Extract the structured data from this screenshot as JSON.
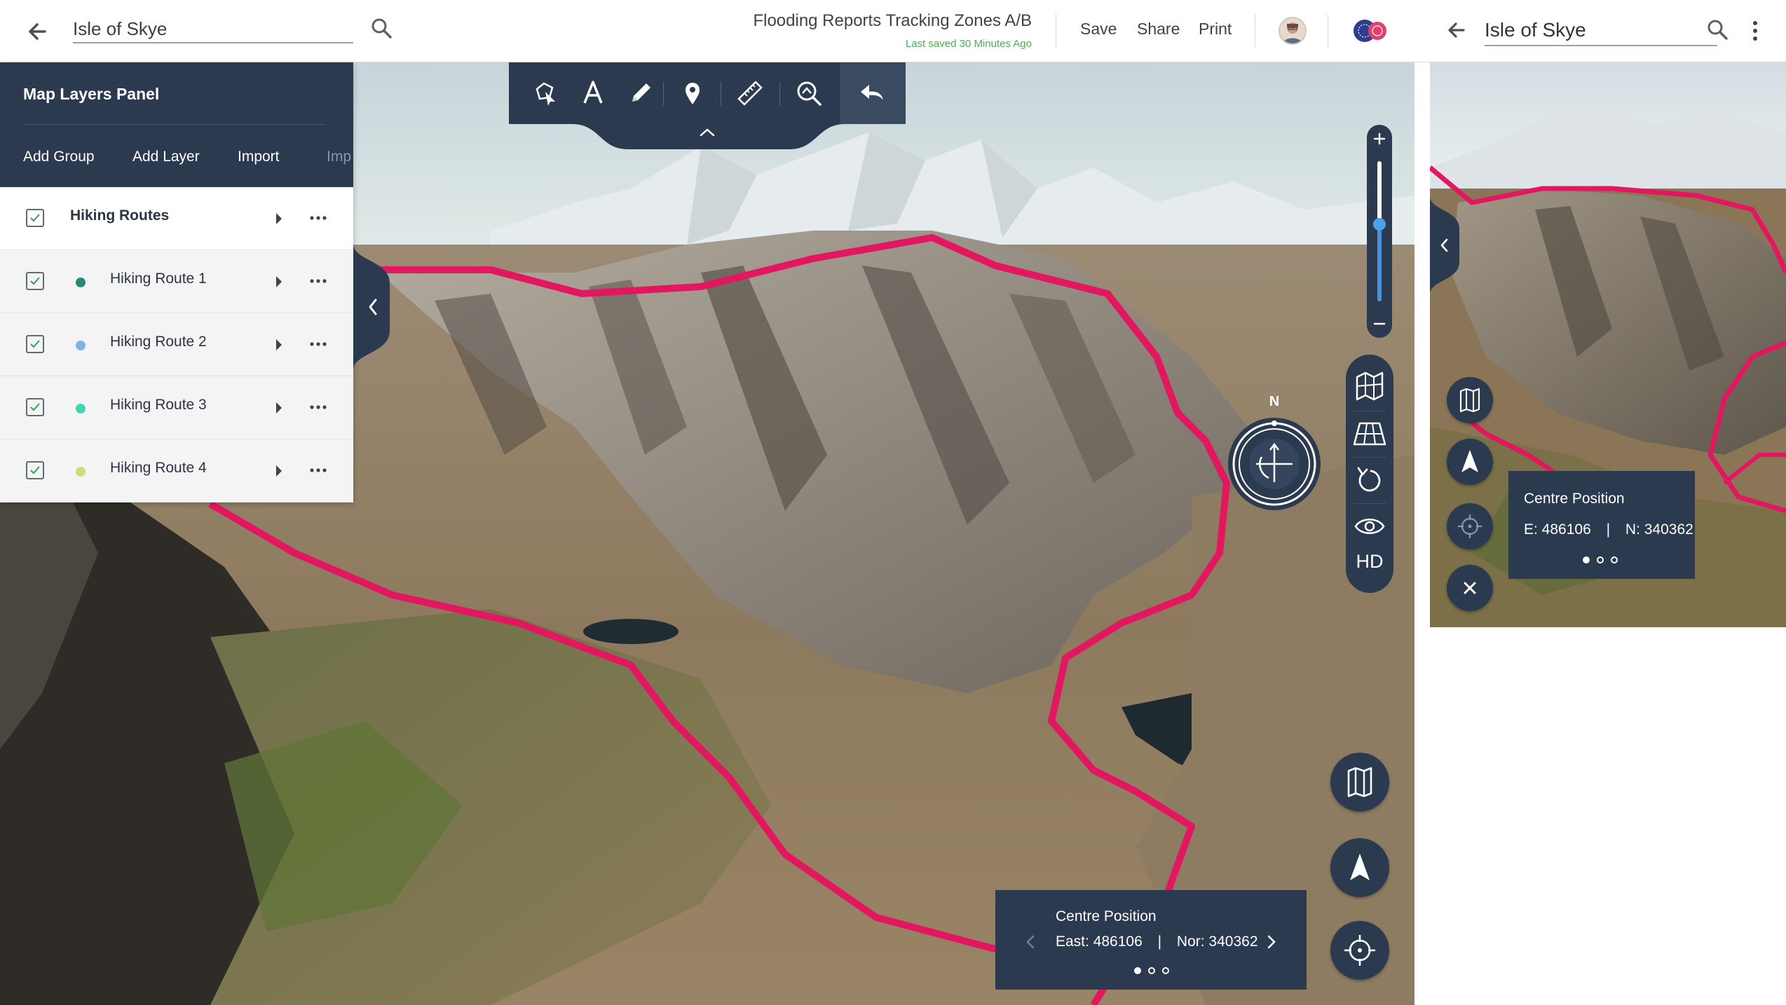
{
  "header": {
    "search_value": "Isle of Skye",
    "document_title": "Flooding Reports Tracking Zones A/B",
    "last_saved": "Last saved 30 Minutes Ago",
    "save_label": "Save",
    "share_label": "Share",
    "print_label": "Print"
  },
  "layers_panel": {
    "title": "Map Layers Panel",
    "actions": [
      "Add Group",
      "Add Layer",
      "Import",
      "Imp"
    ],
    "group": {
      "label": "Hiking Routes",
      "checked": true
    },
    "items": [
      {
        "label": "Hiking Route 1",
        "color": "#2a8a78",
        "checked": true
      },
      {
        "label": "Hiking Route 2",
        "color": "#7fb3e6",
        "checked": true
      },
      {
        "label": "Hiking Route 3",
        "color": "#3fd6b0",
        "checked": true
      },
      {
        "label": "Hiking Route 4",
        "color": "#c8e07a",
        "checked": true
      }
    ]
  },
  "toolbar": {
    "tools": [
      "shape-select-icon",
      "text-icon",
      "pencil-icon",
      "map-pin-icon",
      "ruler-icon",
      "search-area-icon",
      "undo-icon"
    ]
  },
  "map_controls": {
    "zoom_level": 0.55,
    "compass_label": "N",
    "view_buttons": [
      "map-3d-icon",
      "perspective-grid-icon",
      "rotate-icon",
      "eye-icon"
    ],
    "hd_label": "HD"
  },
  "centre_position": {
    "title": "Centre Position",
    "east": "East: 486106",
    "separator": "|",
    "north": "Nor: 340362",
    "page": 1,
    "pages": 3
  },
  "mobile": {
    "search_value": "Isle of Skye",
    "centre_title": "Centre Position",
    "east": "E: 486106",
    "separator": "|",
    "north": "N: 340362"
  },
  "colors": {
    "panel_navy": "#2b3a4e",
    "route_pink": "#e3175f",
    "saved_green": "#4caf50",
    "zoom_blue": "#4aa3e8"
  }
}
